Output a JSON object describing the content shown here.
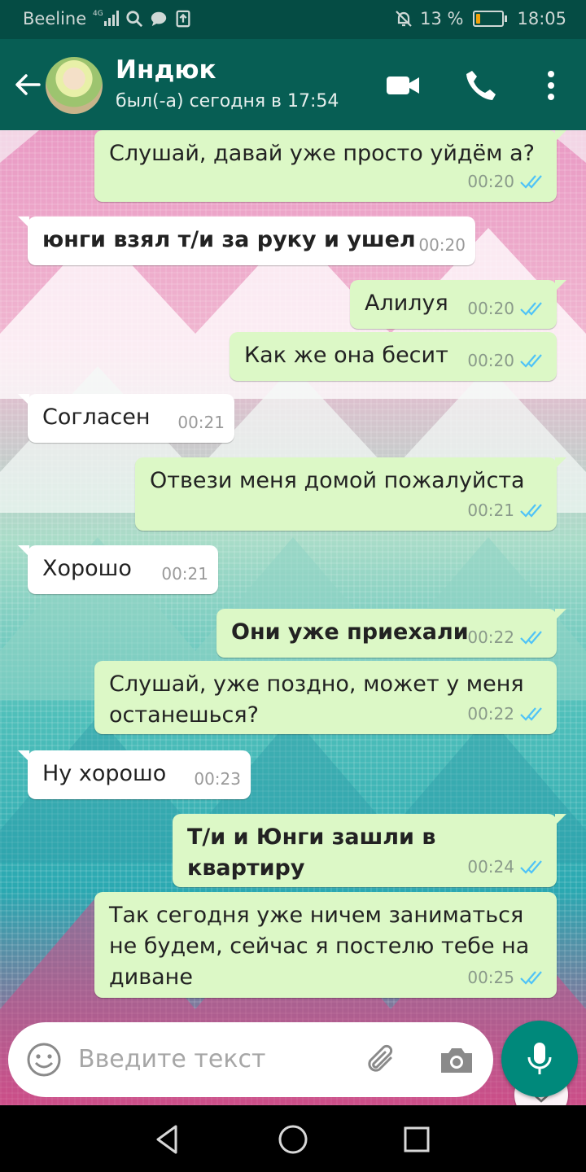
{
  "status_bar": {
    "carrier": "Beeline",
    "network": "4G",
    "battery": "13 %",
    "battery_level": 0.13,
    "time": "18:05"
  },
  "header": {
    "contact_name": "Индюк",
    "last_seen": "был(-а) сегодня в 17:54",
    "icons": [
      "back-arrow-icon",
      "video-call-icon",
      "phone-icon",
      "more-vert-icon"
    ]
  },
  "messages": [
    {
      "dir": "out",
      "text": "Слушай, давай уже просто уйдём а?",
      "time": "00:20",
      "read": true,
      "bold": false
    },
    {
      "dir": "in",
      "text": "юнги взял т/и за руку и ушел",
      "time": "00:20",
      "bold": true
    },
    {
      "dir": "out",
      "text": "Алилуя",
      "time": "00:20",
      "read": true,
      "bold": false
    },
    {
      "dir": "out",
      "text": "Как же она бесит",
      "time": "00:20",
      "read": true,
      "bold": false
    },
    {
      "dir": "in",
      "text": "Согласен",
      "time": "00:21",
      "bold": false
    },
    {
      "dir": "out",
      "text": "Отвези меня домой пожалуйста",
      "time": "00:21",
      "read": true,
      "bold": false
    },
    {
      "dir": "in",
      "text": "Хорошо",
      "time": "00:21",
      "bold": false
    },
    {
      "dir": "out",
      "text": "Они уже приехали",
      "time": "00:22",
      "read": true,
      "bold": true
    },
    {
      "dir": "out",
      "text": "Слушай, уже поздно, может у меня останешься?",
      "time": "00:22",
      "read": true,
      "bold": false
    },
    {
      "dir": "in",
      "text": "Ну хорошо",
      "time": "00:23",
      "bold": false
    },
    {
      "dir": "out",
      "text": "Т/и и Юнги зашли в квартиру",
      "time": "00:24",
      "read": true,
      "bold": true
    },
    {
      "dir": "out",
      "text": "Так сегодня уже ничем заниматься не будем, сейчас я постелю тебе на диване",
      "time": "00:25",
      "read": true,
      "bold": false
    }
  ],
  "composer": {
    "placeholder": "Введите текст",
    "icons": [
      "emoji-icon",
      "attach-icon",
      "camera-icon",
      "mic-icon"
    ]
  },
  "colors": {
    "header": "#075e54",
    "statusbar": "#054c44",
    "outgoing_bubble": "#dcf8c6",
    "incoming_bubble": "#ffffff",
    "read_ticks": "#4fc3f7",
    "mic_button": "#00897b"
  }
}
